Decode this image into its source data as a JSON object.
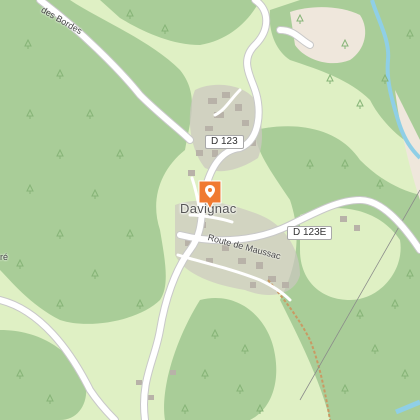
{
  "map": {
    "town_label": "Davignac",
    "road_labels": {
      "chemin_bordes": "des Bordes",
      "route_maussac": "Route de Maussac",
      "edge_fragment": "ré"
    },
    "route_shields": [
      "D 123",
      "D 123E"
    ],
    "marker": {
      "icon": "map-pin-icon",
      "color": "#f07a31"
    },
    "colors": {
      "forest": "#a9cd98",
      "meadow": "#dff0c4",
      "river": "#8fcfe6",
      "road": "#ffffff",
      "track": "#c99a63",
      "village": "#ccc8c0",
      "buildings": "#b8b2a8"
    }
  }
}
